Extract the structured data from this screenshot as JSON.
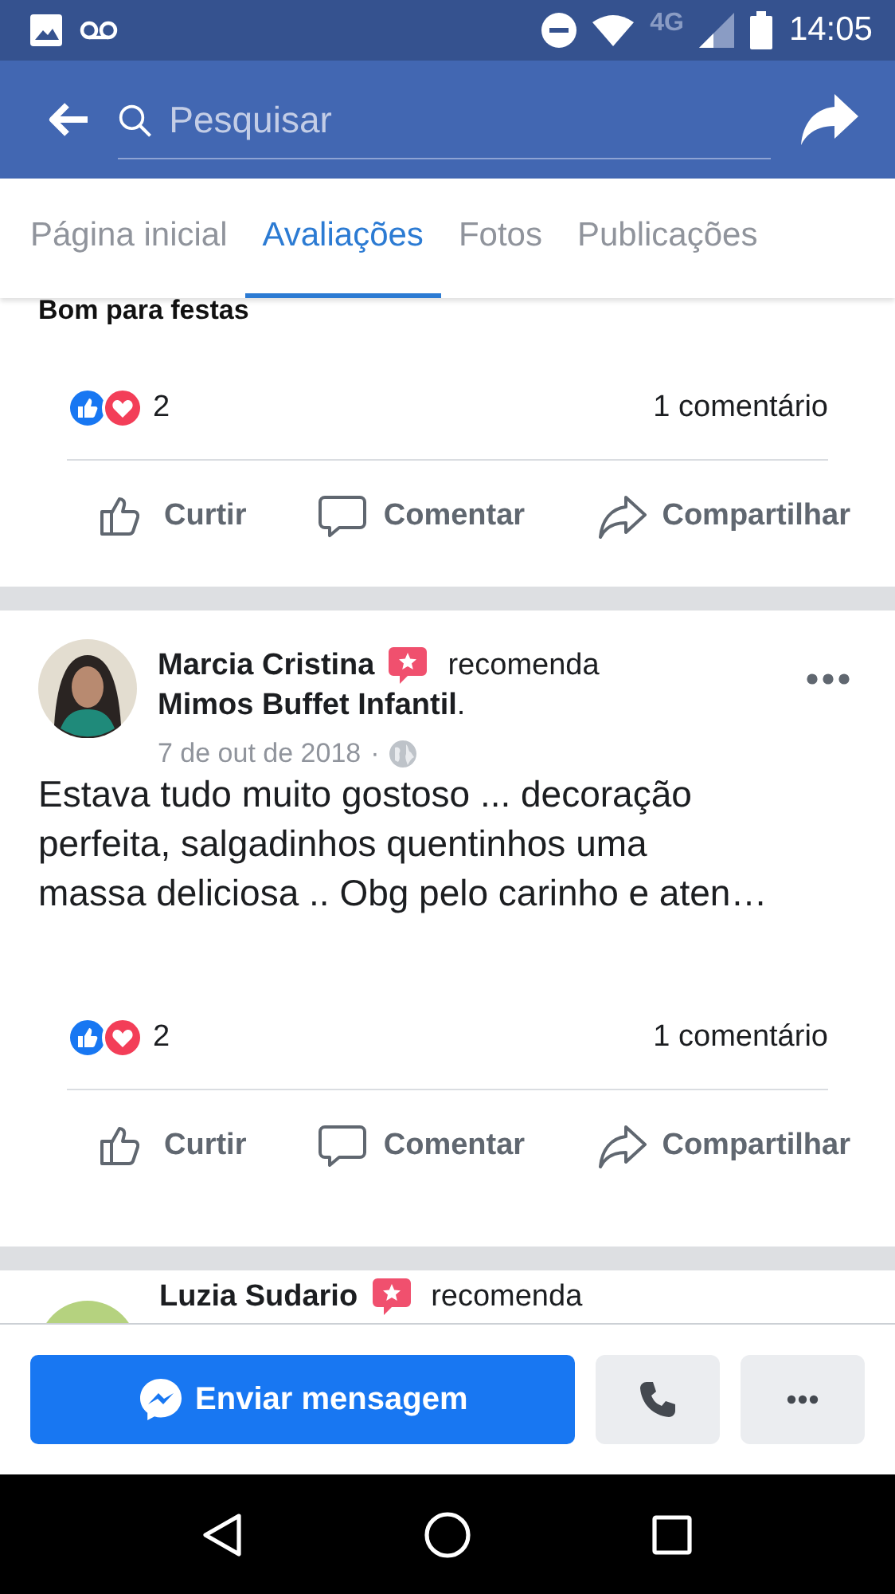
{
  "status_bar": {
    "network": "4G",
    "time": "14:05"
  },
  "header": {
    "search": {
      "placeholder": "Pesquisar"
    }
  },
  "tabs": [
    {
      "label": "Página inicial",
      "selected": false
    },
    {
      "label": "Avaliações",
      "selected": true
    },
    {
      "label": "Fotos",
      "selected": false
    },
    {
      "label": "Publicações",
      "selected": false
    }
  ],
  "posts": [
    {
      "kind": "cut_top",
      "text": "Bom para festas",
      "reaction_count": "2",
      "comments": "1 comentário",
      "actions": [
        "Curtir",
        "Comentar",
        "Compartilhar"
      ]
    },
    {
      "kind": "review",
      "author": "Marcia Cristina",
      "verb": "recomenda",
      "page": "Mimos Buffet Infantil",
      "page_end": ".",
      "date": "7 de out de 2018",
      "separator": "·",
      "text": "Estava tudo muito gostoso ... decoração\nperfeita, salgadinhos quentinhos uma\nmassa deliciosa .. Obg pelo carinho e aten…",
      "reaction_count": "2",
      "comments": "1 comentário",
      "actions": [
        "Curtir",
        "Comentar",
        "Compartilhar"
      ]
    },
    {
      "kind": "cut_bottom",
      "author": "Luzia Sudario",
      "verb": "recomenda"
    }
  ],
  "bottom_bar": {
    "message_button": "Enviar mensagem"
  }
}
